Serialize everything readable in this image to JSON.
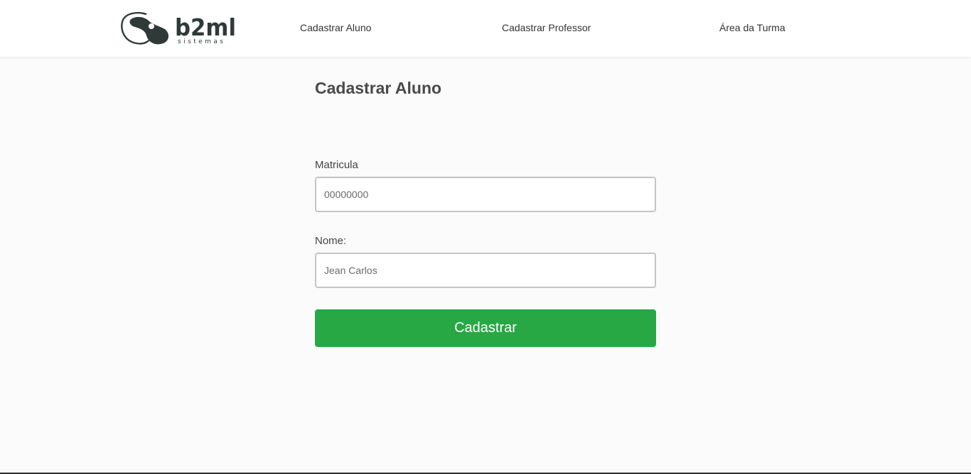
{
  "header": {
    "logo": {
      "brand_text": "b2ml",
      "brand_subtext": "sistemas"
    },
    "nav": [
      {
        "label": "Cadastrar Aluno"
      },
      {
        "label": "Cadastrar Professor"
      },
      {
        "label": "Área da Turma"
      }
    ]
  },
  "form": {
    "title": "Cadastrar Aluno",
    "fields": {
      "matricula": {
        "label": "Matricula",
        "placeholder": "00000000",
        "value": ""
      },
      "nome": {
        "label": "Nome:",
        "placeholder": "Jean Carlos",
        "value": ""
      }
    },
    "submit_label": "Cadastrar"
  },
  "colors": {
    "submit_button": "#28a745",
    "header_background": "#ffffff",
    "page_background": "#fbfbfb",
    "text": "#4a4a4a"
  }
}
